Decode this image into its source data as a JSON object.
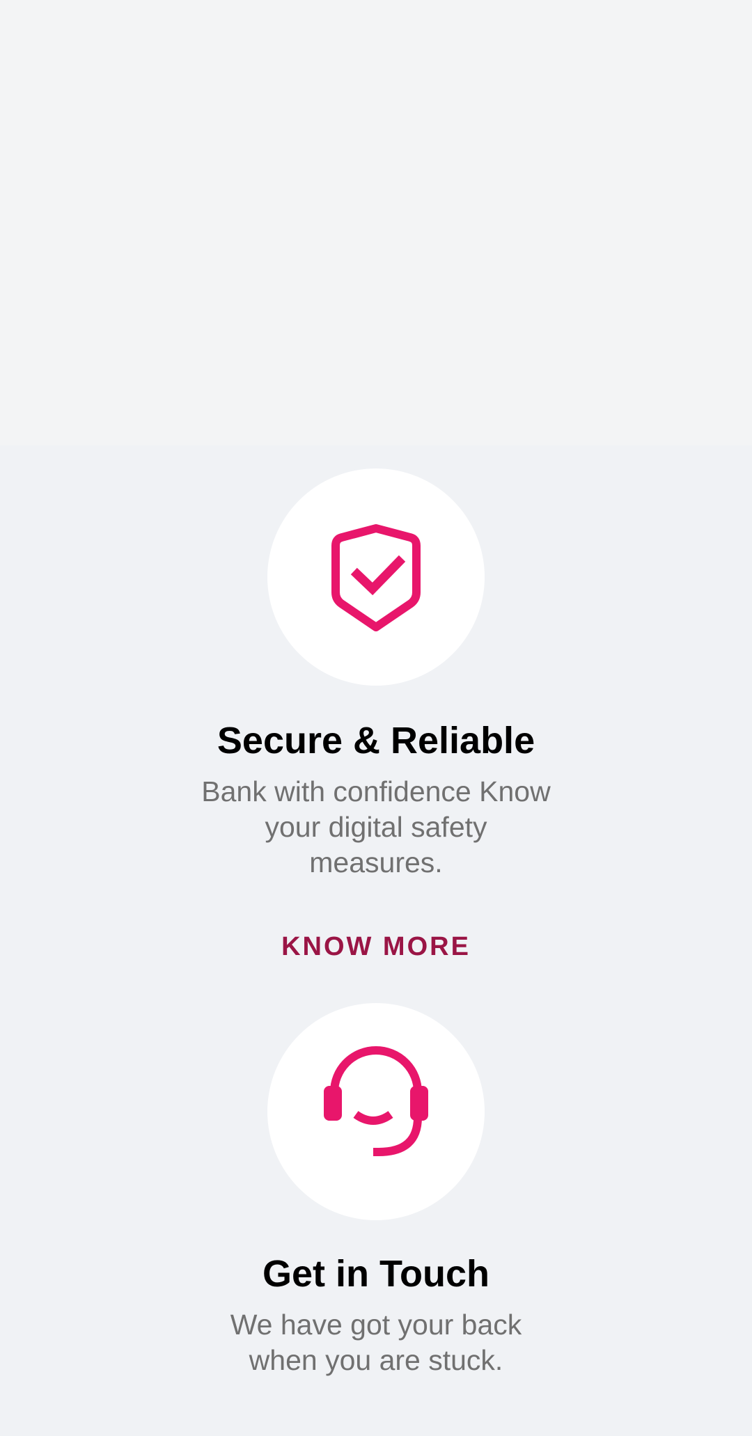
{
  "colors": {
    "accent": "#e8166b",
    "link": "#9a1545",
    "title": "#000000",
    "body_text": "#707070",
    "background": "#f0f2f5",
    "circle": "#ffffff"
  },
  "features": [
    {
      "icon": "shield-check-icon",
      "title": "Secure & Reliable",
      "description_lines": [
        "Bank with confidence Know",
        "your digital safety",
        "measures."
      ],
      "link_label": "KNOW MORE"
    },
    {
      "icon": "headset-icon",
      "title": "Get in Touch",
      "description_lines": [
        "We have got your back",
        "when you are stuck."
      ]
    }
  ]
}
